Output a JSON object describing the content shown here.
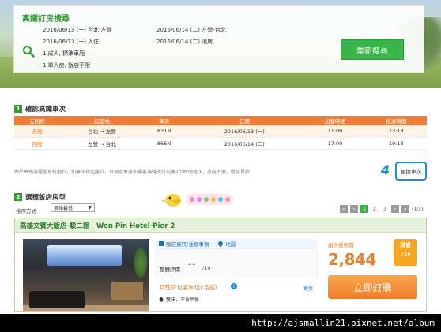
{
  "search": {
    "title": "高鐵訂房搜尋",
    "rows": [
      {
        "left": "2016/06/13 (一) 台北-左營",
        "right": "2016/06/14 (二) 左營-台北"
      },
      {
        "left": "2016/06/13 (一) 入住",
        "right": "2016/06/14 (二) 退房"
      },
      {
        "left": "1 成人, 標準車廂",
        "right": ""
      },
      {
        "left": "1 單人房, 飯店不限",
        "right": ""
      }
    ],
    "research_button": "重新搜尋"
  },
  "section1": {
    "num": "1",
    "title": "確認高鐵車次"
  },
  "train_table": {
    "headers": [
      "去回程",
      "起迄站",
      "車次",
      "日期",
      "出發時間",
      "抵達時間"
    ],
    "rows": [
      [
        "去程",
        "台北 → 左營",
        "831N",
        "2016/06/13 (一)",
        "11:00",
        "13:18"
      ],
      [
        "回程",
        "左營 → 台北",
        "866N",
        "2016/06/14 (二)",
        "17:00",
        "19:18"
      ]
    ]
  },
  "notice": "由於高鐵為電腦系統劃位，如無法指定座位，且預定車班如遇客滿將改訂前後2小時內班次，造成不便，敬請見諒！",
  "change_train": {
    "badge": "4",
    "label": "更換車次"
  },
  "section2": {
    "num": "2",
    "title": "選擇飯店房型"
  },
  "sort": {
    "label": "排序方式",
    "value": "價格最低"
  },
  "pagination": {
    "first": "«",
    "prev": "‹",
    "pages": [
      "1",
      "2",
      "3"
    ],
    "next": "›",
    "last": "»",
    "total": "(1/3)"
  },
  "hotel": {
    "name": "高雄文賓大飯店-駁二館　Wen Pin Hotel-Pier 2",
    "links": {
      "info": "飯店資訊/注意事項",
      "map": "地圖"
    },
    "rating_label": "整體評價",
    "rating_value": "--",
    "rating_max": "/10",
    "room_name": "女性背包客床位(混宿)",
    "room_info": "i",
    "room_change": "更換",
    "room_option": "雙床，不含早餐",
    "price_label": "組合優惠價",
    "price": "2,844",
    "price_unit": "元",
    "cash_tag": {
      "line1": "現省",
      "line2": "734"
    },
    "book_button": "立即訂購"
  },
  "watermark": "http://ajsmallin21.pixnet.net/album"
}
